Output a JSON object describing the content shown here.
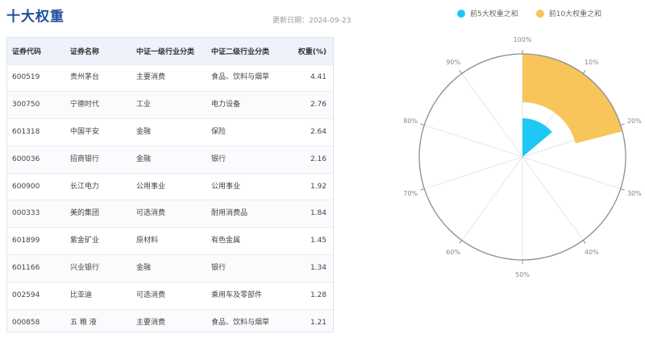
{
  "title": "十大权重",
  "update_date": "更新日期：2024-09-23",
  "table": {
    "headers": [
      "证券代码",
      "证券名称",
      "中证一级行业分类",
      "中证二级行业分类",
      "权重(%)"
    ],
    "rows": [
      [
        "600519",
        "贵州茅台",
        "主要消费",
        "食品、饮料与烟草",
        "4.41"
      ],
      [
        "300750",
        "宁德时代",
        "工业",
        "电力设备",
        "2.76"
      ],
      [
        "601318",
        "中国平安",
        "金融",
        "保险",
        "2.64"
      ],
      [
        "600036",
        "招商银行",
        "金融",
        "银行",
        "2.16"
      ],
      [
        "600900",
        "长江电力",
        "公用事业",
        "公用事业",
        "1.92"
      ],
      [
        "000333",
        "美的集团",
        "可选消费",
        "耐用消费品",
        "1.84"
      ],
      [
        "601899",
        "紫金矿业",
        "原材料",
        "有色金属",
        "1.45"
      ],
      [
        "601166",
        "兴业银行",
        "金融",
        "银行",
        "1.34"
      ],
      [
        "002594",
        "比亚迪",
        "可选消费",
        "乘用车及零部件",
        "1.28"
      ],
      [
        "000858",
        "五 粮 液",
        "主要消费",
        "食品、饮料与烟草",
        "1.21"
      ]
    ]
  },
  "chart_data": {
    "type": "polar-bar",
    "series": [
      {
        "name": "前5大权重之和",
        "value": 13.89,
        "color": "#1fc8f4"
      },
      {
        "name": "前10大权重之和",
        "value": 21.01,
        "color": "#f7c55a"
      }
    ],
    "angle_ticks": [
      "100%",
      "10%",
      "20%",
      "30%",
      "40%",
      "50%",
      "60%",
      "70%",
      "80%",
      "90%"
    ],
    "angle_max": 100
  }
}
